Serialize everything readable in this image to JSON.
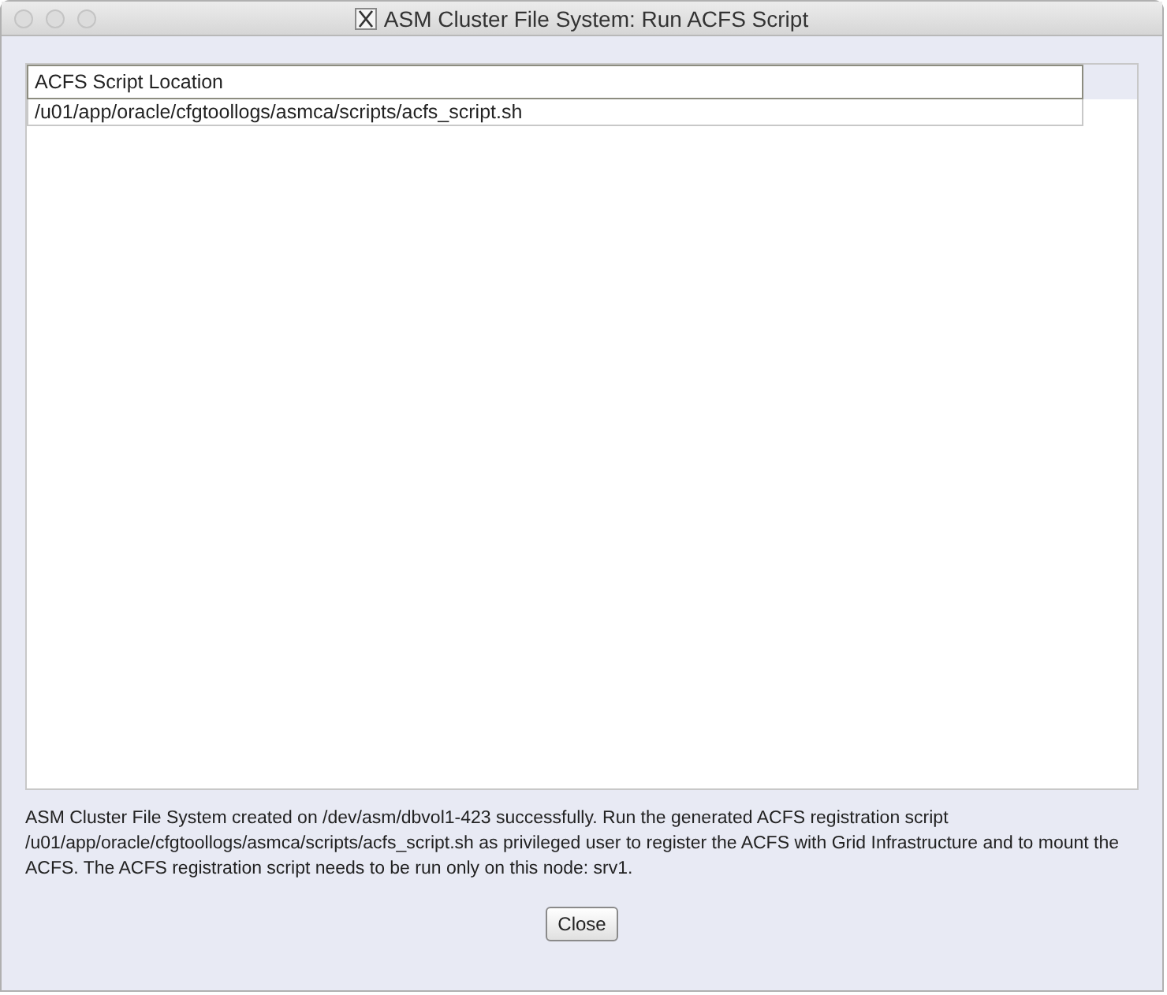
{
  "window": {
    "title": "ASM Cluster File System: Run ACFS Script"
  },
  "table": {
    "columns": [
      "ACFS Script Location"
    ],
    "rows": [
      [
        "/u01/app/oracle/cfgtoollogs/asmca/scripts/acfs_script.sh"
      ]
    ]
  },
  "message": "ASM Cluster File System created on /dev/asm/dbvol1-423 successfully. Run the generated ACFS registration script /u01/app/oracle/cfgtoollogs/asmca/scripts/acfs_script.sh as privileged user to register the ACFS with Grid Infrastructure and to mount the ACFS. The ACFS registration script needs to be run only on this node: srv1.",
  "buttons": [
    "Close"
  ]
}
